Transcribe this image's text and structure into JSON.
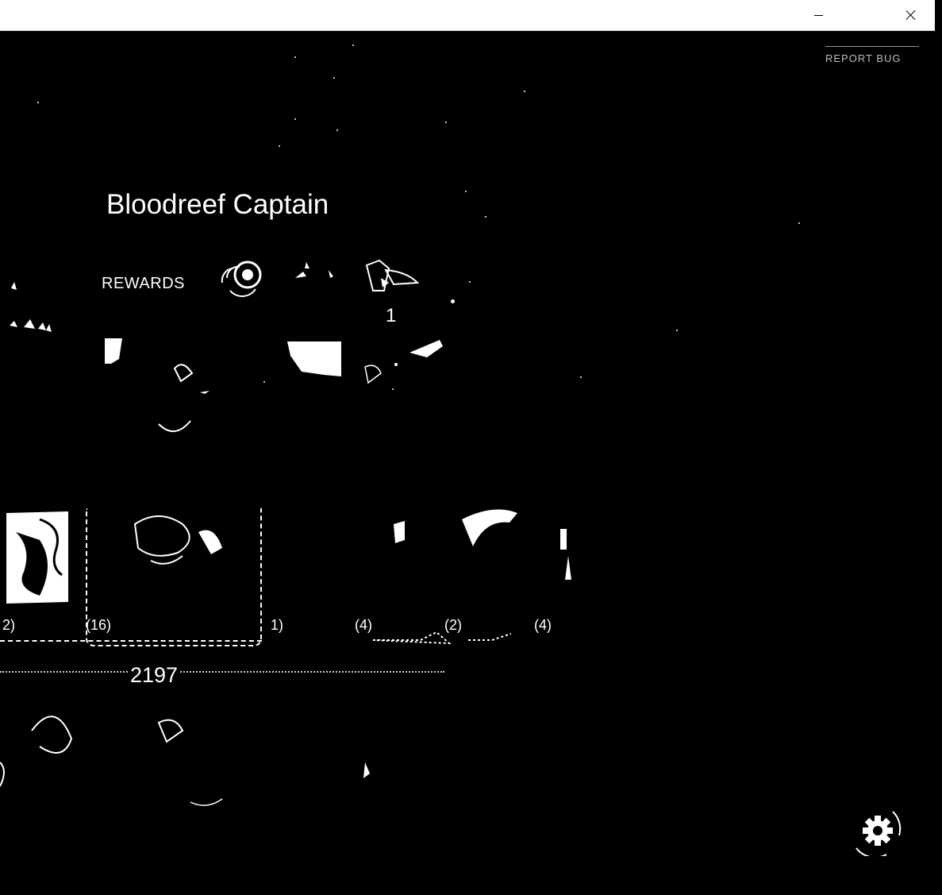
{
  "window": {
    "minimize_icon": "minimize-icon",
    "close_icon": "close-icon"
  },
  "header": {
    "report_bug_label": "REPORT BUG"
  },
  "quest": {
    "title": "Bloodreef Captain",
    "rewards_label": "REWARDS",
    "rewards": [
      {
        "icon": "coin-icon"
      },
      {
        "icon": "claw-icon"
      },
      {
        "icon": "armor-chest-icon",
        "count": "1"
      }
    ]
  },
  "party": {
    "unit_counts": [
      "2",
      "16",
      "1",
      "4",
      "2",
      "4"
    ],
    "power_total": "2197"
  },
  "settings": {
    "icon": "gear-icon"
  }
}
